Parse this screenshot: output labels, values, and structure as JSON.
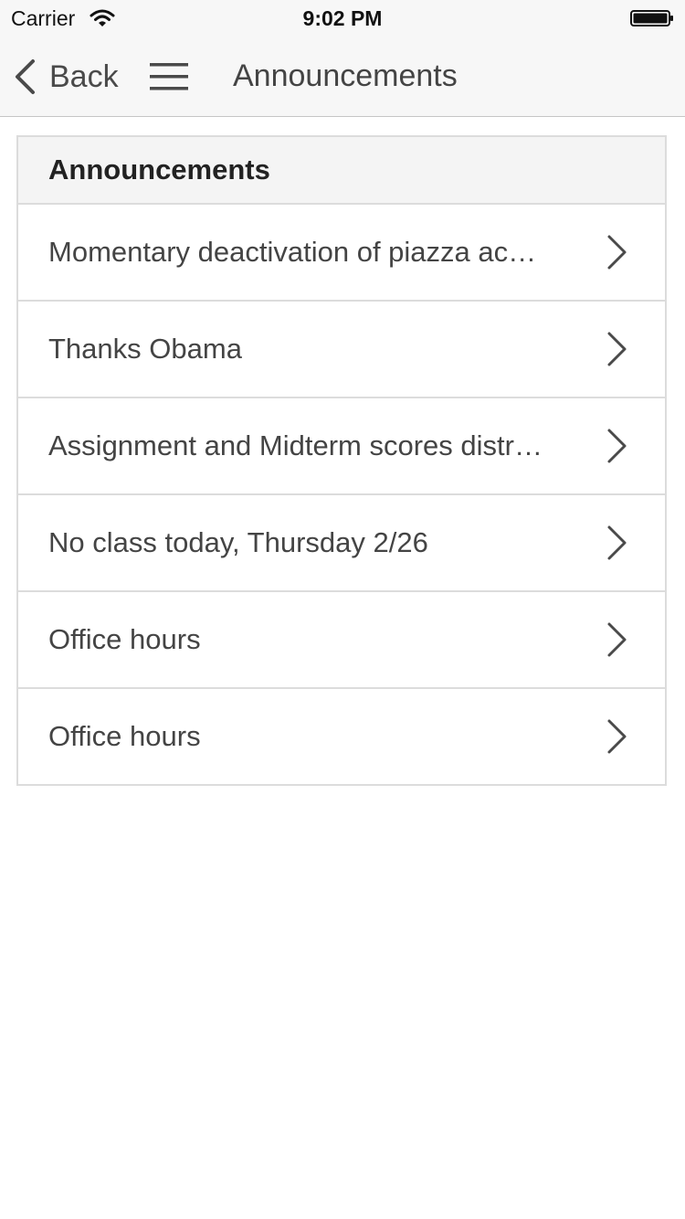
{
  "status_bar": {
    "carrier": "Carrier",
    "time": "9:02 PM"
  },
  "nav_bar": {
    "back_label": "Back",
    "title": "Announcements"
  },
  "panel": {
    "header": "Announcements",
    "items": [
      {
        "label": "Momentary deactivation of piazza ac…"
      },
      {
        "label": "Thanks Obama"
      },
      {
        "label": "Assignment and Midterm scores distr…"
      },
      {
        "label": "No class today, Thursday 2/26"
      },
      {
        "label": "Office hours"
      },
      {
        "label": "Office hours"
      }
    ]
  },
  "icons": {
    "wifi": "wifi-icon",
    "battery": "battery-icon",
    "back": "chevron-left-icon",
    "menu": "hamburger-menu-icon",
    "row": "chevron-right-icon"
  },
  "colors": {
    "bar_background": "#f7f7f7",
    "border": "#dcdcdc",
    "text": "#444444"
  }
}
